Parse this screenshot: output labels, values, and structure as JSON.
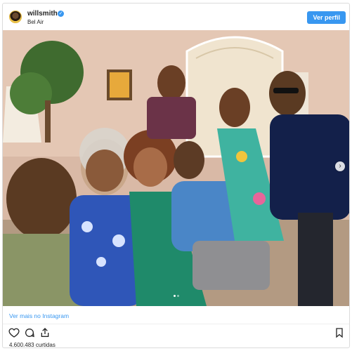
{
  "header": {
    "username": "willsmith",
    "verified_icon": "verified-badge-icon",
    "location": "Bel Air",
    "view_profile_label": "Ver perfil"
  },
  "post": {
    "image_alt": "Group photo of eight people in a living room",
    "carousel": {
      "count": 2,
      "active": 1
    }
  },
  "footer": {
    "view_more_label": "Ver mais no Instagram",
    "likes_text": "4.600.483 curtidas",
    "icons": [
      "heart-icon",
      "comment-icon",
      "share-icon",
      "bookmark-icon"
    ]
  },
  "colors": {
    "accent": "#3897f0",
    "text": "#262626",
    "border": "#dbdbdb"
  }
}
